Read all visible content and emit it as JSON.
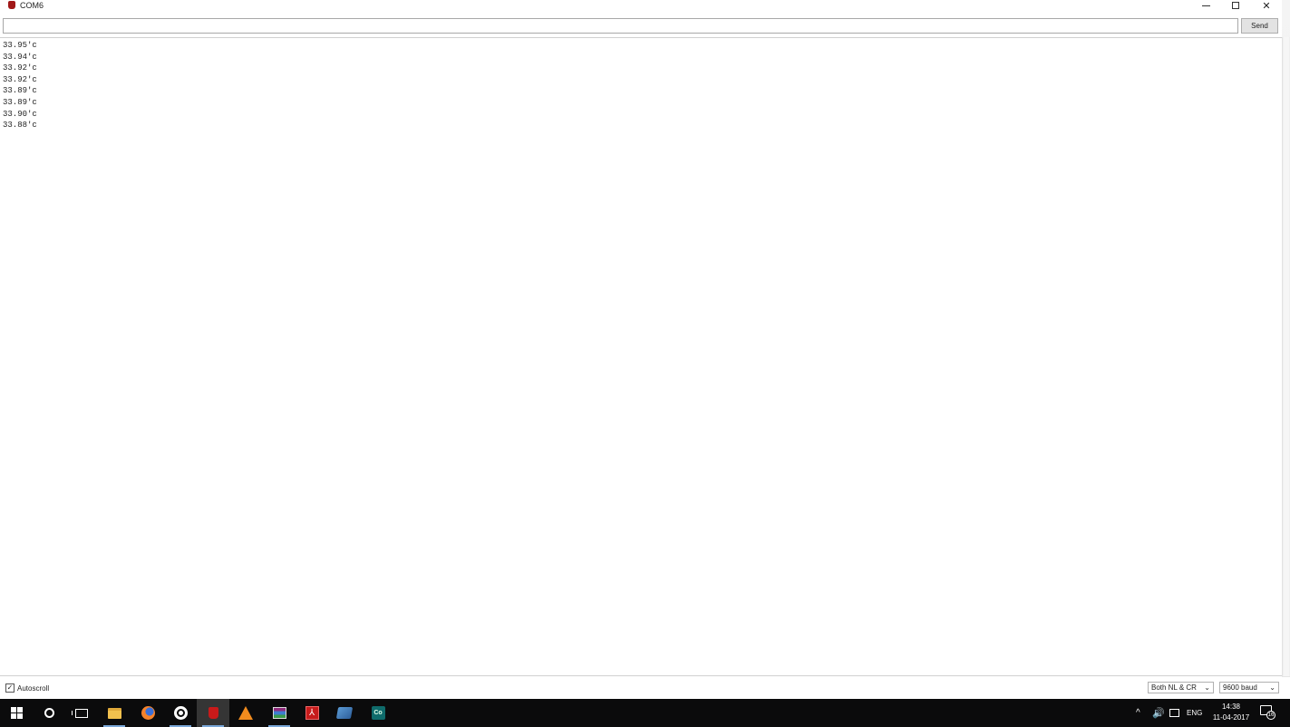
{
  "window": {
    "title": "COM6",
    "min_glyph": "",
    "max_glyph": "",
    "close_glyph": "✕"
  },
  "send_bar": {
    "input_value": "",
    "input_placeholder": "",
    "send_label": "Send"
  },
  "output": {
    "lines": [
      "33.95'c",
      "33.94'c",
      "33.92'c",
      "33.92'c",
      "33.89'c",
      "33.89'c",
      "33.90'c",
      "33.88'c"
    ]
  },
  "bottom_bar": {
    "autoscroll_label": "Autoscroll",
    "autoscroll_checked": true,
    "line_ending": "Both NL & CR",
    "baud_rate": "9600 baud"
  },
  "taskbar": {
    "apps": [
      {
        "name": "start-button",
        "icon": "windows-icon"
      },
      {
        "name": "search-button",
        "icon": "cortana-icon"
      },
      {
        "name": "task-view-button",
        "icon": "task-view-icon"
      },
      {
        "name": "file-explorer",
        "icon": "folder-icon"
      },
      {
        "name": "firefox",
        "icon": "firefox-icon"
      },
      {
        "name": "browser",
        "icon": "chrome-icon"
      },
      {
        "name": "arduino-app",
        "icon": "red-app-icon",
        "active": true
      },
      {
        "name": "vlc",
        "icon": "vlc-icon"
      },
      {
        "name": "winrar",
        "icon": "winrar-icon"
      },
      {
        "name": "acrobat",
        "icon": "acrobat-icon"
      },
      {
        "name": "network-app",
        "icon": "network-app-icon"
      },
      {
        "name": "co-app",
        "icon": "co-app-icon",
        "label": "Co"
      }
    ],
    "tray": {
      "chevron": "^",
      "volume": "🔊",
      "lang": "ENG",
      "time": "14:38",
      "date": "11-04-2017",
      "notification_count": "16"
    },
    "colors": {
      "background": "#0b0b0c",
      "active": "#353535",
      "accent": "#7aa7d8"
    }
  }
}
